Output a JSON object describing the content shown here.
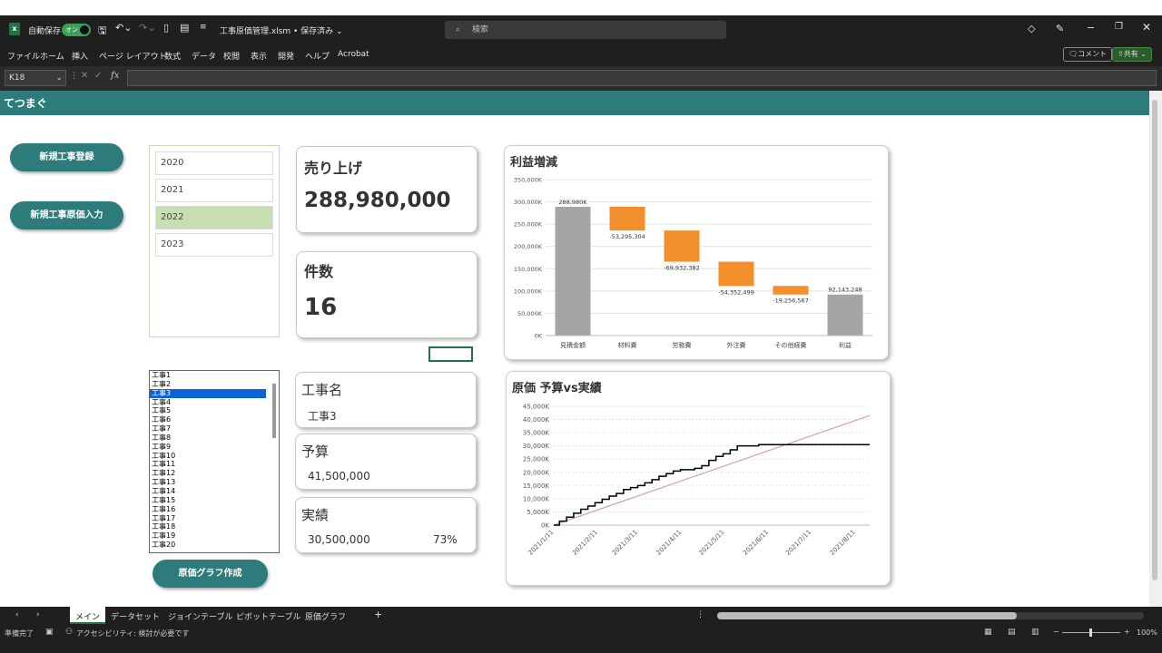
{
  "titlebar": {
    "autosave_label": "自動保存",
    "autosave_state": "オン",
    "filename": "工事原価管理.xlsm • 保存済み ⌄",
    "search_placeholder": "検索"
  },
  "ribbon": {
    "menus": [
      "ファイル",
      "ホーム",
      "挿入",
      "ページ レイアウト",
      "数式",
      "データ",
      "校閲",
      "表示",
      "開発",
      "ヘルプ",
      "Acrobat"
    ],
    "comment_label": "コメント",
    "share_label": "共有"
  },
  "formula_bar": {
    "cell": "K18",
    "fx": "fx"
  },
  "band": {
    "logo": "てつまぐ"
  },
  "buttons": {
    "new_project": "新規工事登録",
    "new_cost": "新規工事原価入力",
    "cost_graph": "原価グラフ作成"
  },
  "years": [
    "2020",
    "2021",
    "2022",
    "2023"
  ],
  "selected_year": "2022",
  "projects": [
    "工事1",
    "工事2",
    "工事3",
    "工事4",
    "工事5",
    "工事6",
    "工事7",
    "工事8",
    "工事9",
    "工事10",
    "工事11",
    "工事12",
    "工事13",
    "工事14",
    "工事15",
    "工事16",
    "工事17",
    "工事18",
    "工事19",
    "工事20"
  ],
  "selected_project": "工事3",
  "cards": {
    "sales_label": "売り上げ",
    "sales_value": "288,980,000",
    "count_label": "件数",
    "count_value": "16",
    "name_label": "工事名",
    "name_value": "工事3",
    "budget_label": "予算",
    "budget_value": "41,500,000",
    "actual_label": "実績",
    "actual_value": "30,500,000",
    "actual_pct": "73%"
  },
  "sheet_tabs": [
    "メイン",
    "データセット",
    "ジョインテーブル",
    "ピボットテーブル",
    "原価グラフ"
  ],
  "active_tab": "メイン",
  "status": {
    "ready": "準備完了",
    "accessibility": "アクセシビリティ: 検討が必要です",
    "zoom": "100%"
  },
  "colors": {
    "teal": "#2e7b7b",
    "orange": "#f28e2b",
    "gray": "#a5a5a5",
    "budget_line": "#d4a49a",
    "actual_line": "#000000"
  },
  "chart_data": [
    {
      "type": "bar",
      "subtype": "waterfall",
      "title": "利益増減",
      "categories": [
        "見積金額",
        "材料費",
        "労務費",
        "外注費",
        "その他経費",
        "利益"
      ],
      "values": [
        288980000,
        -53295304,
        -69932382,
        -54352499,
        -19256567,
        92143248
      ],
      "data_labels": [
        "288,980K",
        "-53,295,304",
        "-69,932,382",
        "-54,352,499",
        "-19,256,567",
        "92,143,248"
      ],
      "ylim": [
        0,
        350000
      ],
      "y_ticks": [
        "0K",
        "50,000K",
        "100,000K",
        "150,000K",
        "200,000K",
        "250,000K",
        "300,000K",
        "350,000K"
      ],
      "grid": true
    },
    {
      "type": "line",
      "title": "原価 予算vs実績",
      "x_ticks": [
        "2021/1/11",
        "2021/2/11",
        "2021/3/11",
        "2021/4/11",
        "2021/5/11",
        "2021/6/11",
        "2021/7/11",
        "2021/8/11"
      ],
      "y_ticks": [
        "0K",
        "5,000K",
        "10,000K",
        "15,000K",
        "20,000K",
        "25,000K",
        "30,000K",
        "35,000K",
        "40,000K",
        "45,000K"
      ],
      "ylim": [
        0,
        45000
      ],
      "xlim": [
        "2021/1/11",
        "2021/8/21"
      ],
      "series": [
        {
          "x": [
            "2021/1/11",
            "2021/8/21"
          ],
          "values": [
            0,
            41500
          ]
        },
        {
          "x": [
            "2021/1/11",
            "2021/1/15",
            "2021/1/20",
            "2021/1/25",
            "2021/1/30",
            "2021/2/4",
            "2021/2/9",
            "2021/2/14",
            "2021/2/19",
            "2021/2/24",
            "2021/3/1",
            "2021/3/6",
            "2021/3/11",
            "2021/3/16",
            "2021/3/21",
            "2021/3/26",
            "2021/3/31",
            "2021/4/5",
            "2021/4/10",
            "2021/4/15",
            "2021/4/20",
            "2021/4/25",
            "2021/4/30",
            "2021/5/5",
            "2021/5/10",
            "2021/5/15",
            "2021/5/20",
            "2021/5/25",
            "2021/5/30",
            "2021/6/4",
            "2021/6/9",
            "2021/6/14",
            "2021/6/19",
            "2021/8/21"
          ],
          "values": [
            0,
            1500,
            3000,
            4500,
            6000,
            7200,
            8500,
            9800,
            11000,
            12000,
            13500,
            14200,
            15000,
            16000,
            17200,
            18500,
            19500,
            20500,
            21000,
            21000,
            21500,
            22500,
            24500,
            26000,
            27000,
            28500,
            30000,
            30000,
            30000,
            30500,
            30500,
            30500,
            30500,
            30500
          ]
        }
      ],
      "grid": true
    }
  ]
}
